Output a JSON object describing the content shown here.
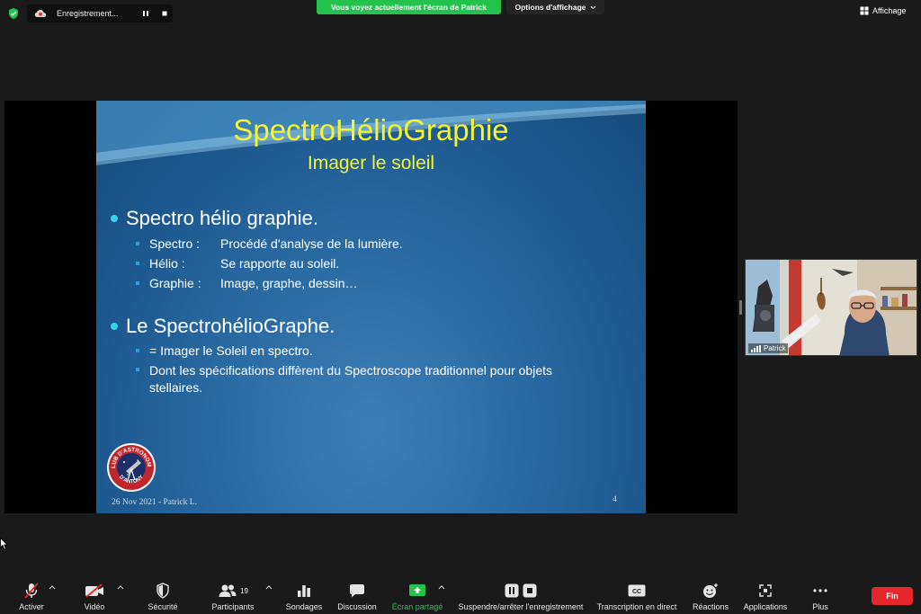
{
  "topbar": {
    "recording_label": "Enregistrement...",
    "share_banner": "Vous voyez actuellement l'écran de Patrick",
    "view_options": "Options d'affichage",
    "view_button": "Affichage"
  },
  "slide": {
    "title": "SpectroHélioGraphie",
    "subtitle": "Imager le soleil",
    "bullet1": "Spectro hélio graphie.",
    "sub1": [
      {
        "term": "Spectro  :",
        "desc": "Procédé d'analyse de la lumière."
      },
      {
        "term": "Hélio :",
        "desc": "Se rapporte au soleil."
      },
      {
        "term": "Graphie :",
        "desc": "Image, graphe, dessin…"
      }
    ],
    "bullet2": "Le SpectrohélioGraphe.",
    "sub2": [
      "= Imager le Soleil en spectro.",
      "Dont les spécifications diffèrent du Spectroscope traditionnel pour objets stellaires."
    ],
    "footer_date": "26 Nov 2021 - Patrick L.",
    "page_number": "4",
    "logo_text_top": "CLUB D'ASTRONOMIE",
    "logo_text_bottom": "D'ANTONY"
  },
  "participant": {
    "name": "Patrick"
  },
  "toolbar": {
    "activer": "Activer",
    "video": "Vidéo",
    "securite": "Sécurité",
    "participants": "Participants",
    "participants_count": "19",
    "sondages": "Sondages",
    "discussion": "Discussion",
    "ecran_partage": "Écran partagé",
    "suspendre": "Suspendre/arrêter l'enregistrement",
    "transcription": "Transcription en direct",
    "reactions": "Réactions",
    "applications": "Applications",
    "plus": "Plus",
    "fin": "Fin",
    "cc": "CC"
  },
  "colors": {
    "accent_green": "#23c34d",
    "end_red": "#e5262a",
    "title_yellow": "#f5f52d",
    "bullet_cyan": "#35d3ee"
  }
}
